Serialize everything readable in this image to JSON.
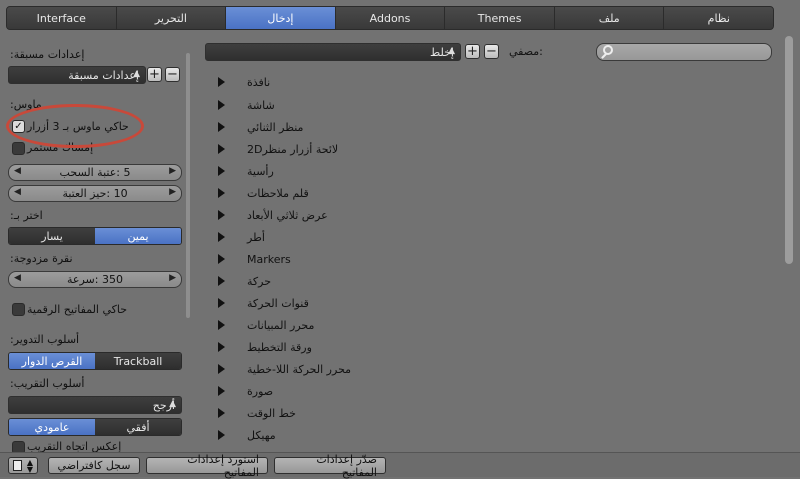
{
  "tabs": [
    "Interface",
    "التحرير",
    "إدخال",
    "Addons",
    "Themes",
    "ملف",
    "نظام"
  ],
  "active_tab_index": 2,
  "left": {
    "presets_label": "إعدادات مسبقة:",
    "presets_value": "إعدادات مسبقة",
    "mouse_label": "ماوس:",
    "emulate3": "حاكي ماوس بـ 3 أزرار",
    "continuous_grab": "إمساك مستمر",
    "drag_threshold": "5 :عتبة السحب",
    "drag_deadzone": "10 :حيز العتبة",
    "select_with_label": "اختر بـ:",
    "select_right": "يمين",
    "select_left": "يسار",
    "double_click_label": "نقرة مزدوجة:",
    "double_click_speed": "350 :سرعة",
    "emulate_numpad": "حاكي المفاتيح الرقمية",
    "orbit_style_label": "أسلوب التدوير:",
    "orbit_turntable": "القرص الدوار",
    "orbit_trackball": "Trackball",
    "zoom_style_label": "أسلوب التقريب:",
    "zoom_style_value": "أرجح",
    "zoom_vertical": "عامودي",
    "zoom_horizontal": "أفقي",
    "invert_zoom": "إعكس اتجاه التقريب"
  },
  "keymap": {
    "dropdown_value": "إخلط",
    "filter_label": ":مصفي",
    "items": [
      "نافذة",
      "شاشة",
      "منظر الثنائي",
      "لائحة أزرار منظر2D",
      "رأسية",
      "قلم ملاحظات",
      "عرض ثلاثي الأبعاد",
      "أطر",
      "Markers",
      "حركة",
      "قنوات الحركة",
      "محرر المبيانات",
      "ورقة التخطيط",
      "محرر الحركة اللا-خطية",
      "صورة",
      "خط الوقت",
      "مهيكل"
    ]
  },
  "bottom": {
    "save_default": "سجل كافتراضي",
    "import_keymap": "استورد إعدادات المفاتيح",
    "export_keymap": "صدّر إعدادات المفاتيح"
  }
}
